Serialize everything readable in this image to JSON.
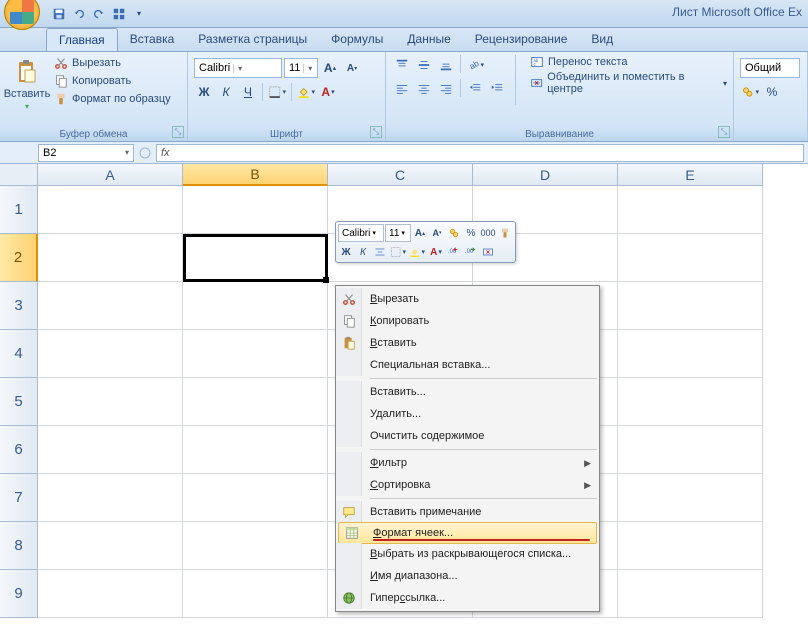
{
  "title": "Лист Microsoft Office Ex",
  "tabs": [
    "Главная",
    "Вставка",
    "Разметка страницы",
    "Формулы",
    "Данные",
    "Рецензирование",
    "Вид"
  ],
  "clipboard": {
    "paste": "Вставить",
    "cut": "Вырезать",
    "copy": "Копировать",
    "format_painter": "Формат по образцу",
    "group": "Буфер обмена"
  },
  "font": {
    "name": "Calibri",
    "size": "11",
    "group": "Шрифт"
  },
  "alignment": {
    "wrap": "Перенос текста",
    "merge": "Объединить и поместить в центре",
    "group": "Выравнивание"
  },
  "number": {
    "format": "Общий"
  },
  "name_box": "B2",
  "mini": {
    "font": "Calibri",
    "size": "11"
  },
  "columns": [
    "A",
    "B",
    "C",
    "D",
    "E"
  ],
  "rows": [
    "1",
    "2",
    "3",
    "4",
    "5",
    "6",
    "7",
    "8",
    "9"
  ],
  "context_menu": {
    "cut": "Вырезать",
    "copy": "Копировать",
    "paste": "Вставить",
    "paste_special": "Специальная вставка...",
    "insert": "Вставить...",
    "delete": "Удалить...",
    "clear": "Очистить содержимое",
    "filter": "Фильтр",
    "sort": "Сортировка",
    "comment": "Вставить примечание",
    "format_cells": "Формат ячеек...",
    "dropdown": "Выбрать из раскрывающегося списка...",
    "range_name": "Имя диапазона...",
    "hyperlink": "Гиперссылка..."
  }
}
